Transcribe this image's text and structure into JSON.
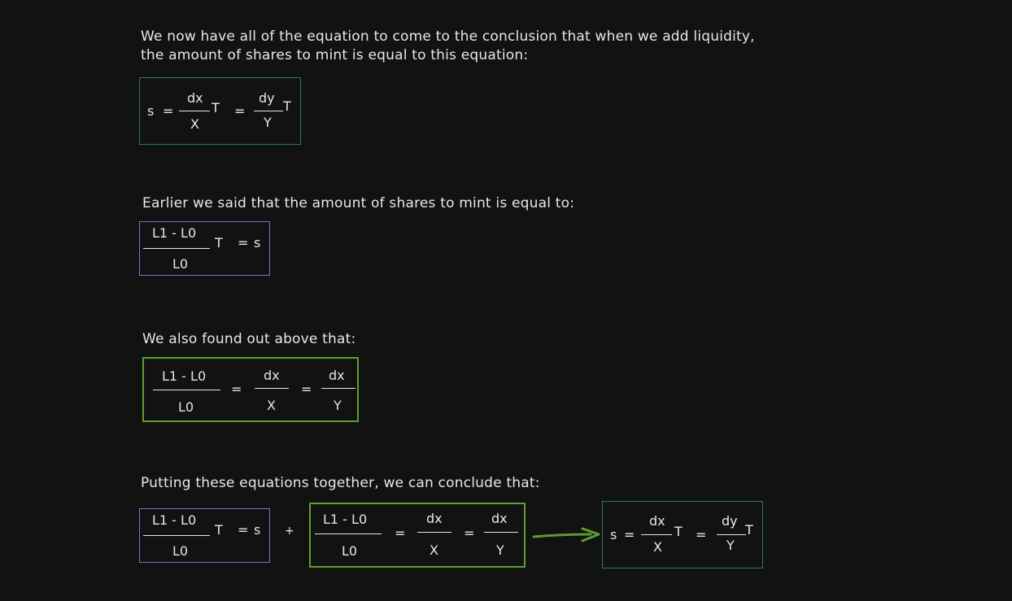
{
  "intro_text": {
    "line1": "We now have all of the equation to come to the conclusion that when we add liquidity,",
    "line2": "the amount of shares to mint is equal to this equation:"
  },
  "share_equation": {
    "s": "s",
    "eq": "=",
    "dx": "dx",
    "x": "X",
    "t": "T",
    "dy": "dy",
    "y": "Y"
  },
  "earlier_text": "Earlier we said that the amount of shares to mint is equal to:",
  "liquidity_equation": {
    "numerator": "L1 - L0",
    "denominator": "L0",
    "t": "T",
    "eq": "=",
    "s": "s"
  },
  "found_text": "We also found out above that:",
  "ratio_equation": {
    "numerator": "L1 - L0",
    "denominator": "L0",
    "eq": "=",
    "dx1": "dx",
    "x": "X",
    "dx2": "dx",
    "y": "Y"
  },
  "conclusion_text": "Putting these equations together, we can conclude that:",
  "plus_sign": "+",
  "colors": {
    "background": "#121212",
    "text": "#e8e8e8",
    "teal_border": "#2f7a5a",
    "purple_border": "#7d6fd6",
    "green_border": "#5d9d32",
    "arrow": "#5d9d32"
  },
  "icons": {
    "arrow": "arrow-right-icon"
  }
}
